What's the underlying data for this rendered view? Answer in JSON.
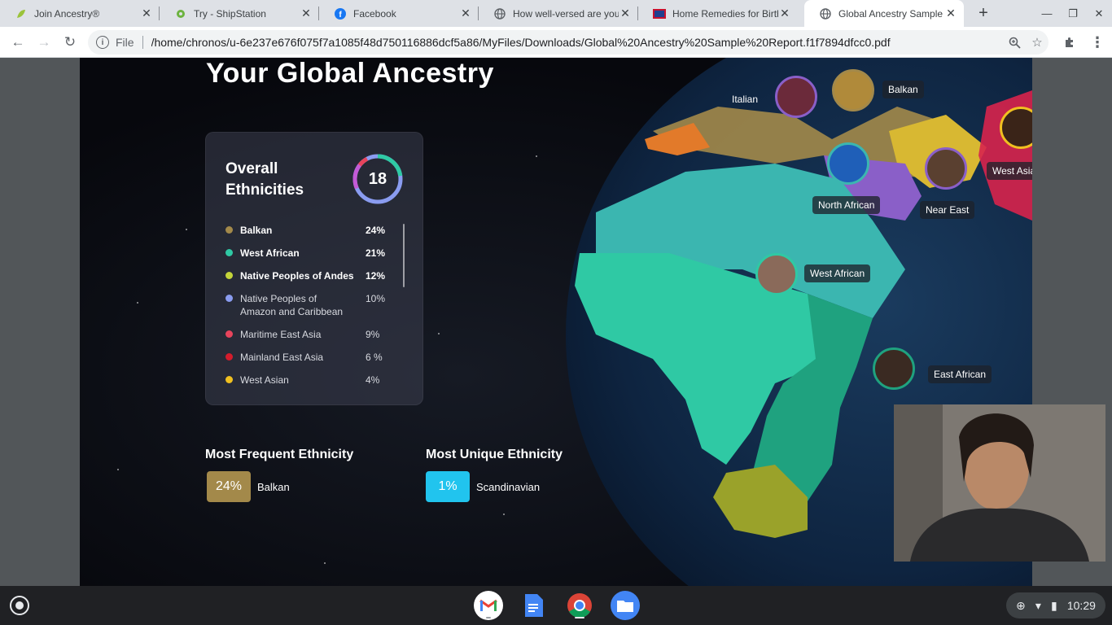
{
  "tabs": [
    {
      "title": "Join Ancestry®",
      "icon": "ancestry-leaf-icon"
    },
    {
      "title": "Try - ShipStation",
      "icon": "shipstation-gear-icon"
    },
    {
      "title": "Facebook",
      "icon": "facebook-icon"
    },
    {
      "title": "How well-versed are you",
      "icon": "globe-icon"
    },
    {
      "title": "Home Remedies for Birth",
      "icon": "site-logo-icon"
    },
    {
      "title": "Global Ancestry Sample",
      "icon": "globe-icon",
      "active": true
    }
  ],
  "address_bar": {
    "scheme_label": "File",
    "url": "/home/chronos/u-6e237e676f075f7a1085f48d750116886dcf5a86/MyFiles/Downloads/Global%20Ancestry%20Sample%20Report.f1f7894dfcc0.pdf"
  },
  "report": {
    "title": "Your Global Ancestry",
    "card": {
      "title": "Overall Ethnicities",
      "count": "18",
      "items": [
        {
          "name": "Balkan",
          "pct": "24%",
          "color": "#a3894a",
          "bold": true
        },
        {
          "name": "West African",
          "pct": "21%",
          "color": "#2fc9a4",
          "bold": true
        },
        {
          "name": "Native Peoples of Andes",
          "pct": "12%",
          "color": "#c4d43a",
          "bold": true
        },
        {
          "name": "Native Peoples of Amazon and Caribbean",
          "pct": "10%",
          "color": "#8a9cf0",
          "bold": false
        },
        {
          "name": "Maritime East Asia",
          "pct": "9%",
          "color": "#e8445c",
          "bold": false
        },
        {
          "name": "Mainland East Asia",
          "pct": "6 %",
          "color": "#d41c2c",
          "bold": false
        },
        {
          "name": "West Asian",
          "pct": "4%",
          "color": "#f0c020",
          "bold": false
        }
      ]
    },
    "most_frequent": {
      "label": "Most Frequent Ethnicity",
      "pct": "24%",
      "name": "Balkan",
      "color": "#a3894a"
    },
    "most_unique": {
      "label": "Most Unique Ethnicity",
      "pct": "1%",
      "name": "Scandinavian",
      "color": "#21c4ee"
    },
    "map_labels": {
      "italian": "Italian",
      "balkan": "Balkan",
      "west_asian": "West Asian",
      "north_african": "North African",
      "near_east": "Near East",
      "west_african": "West African",
      "east_african": "East African"
    }
  },
  "shelf": {
    "apps": [
      "gmail-icon",
      "docs-icon",
      "chrome-icon",
      "files-icon"
    ],
    "time": "10:29"
  }
}
